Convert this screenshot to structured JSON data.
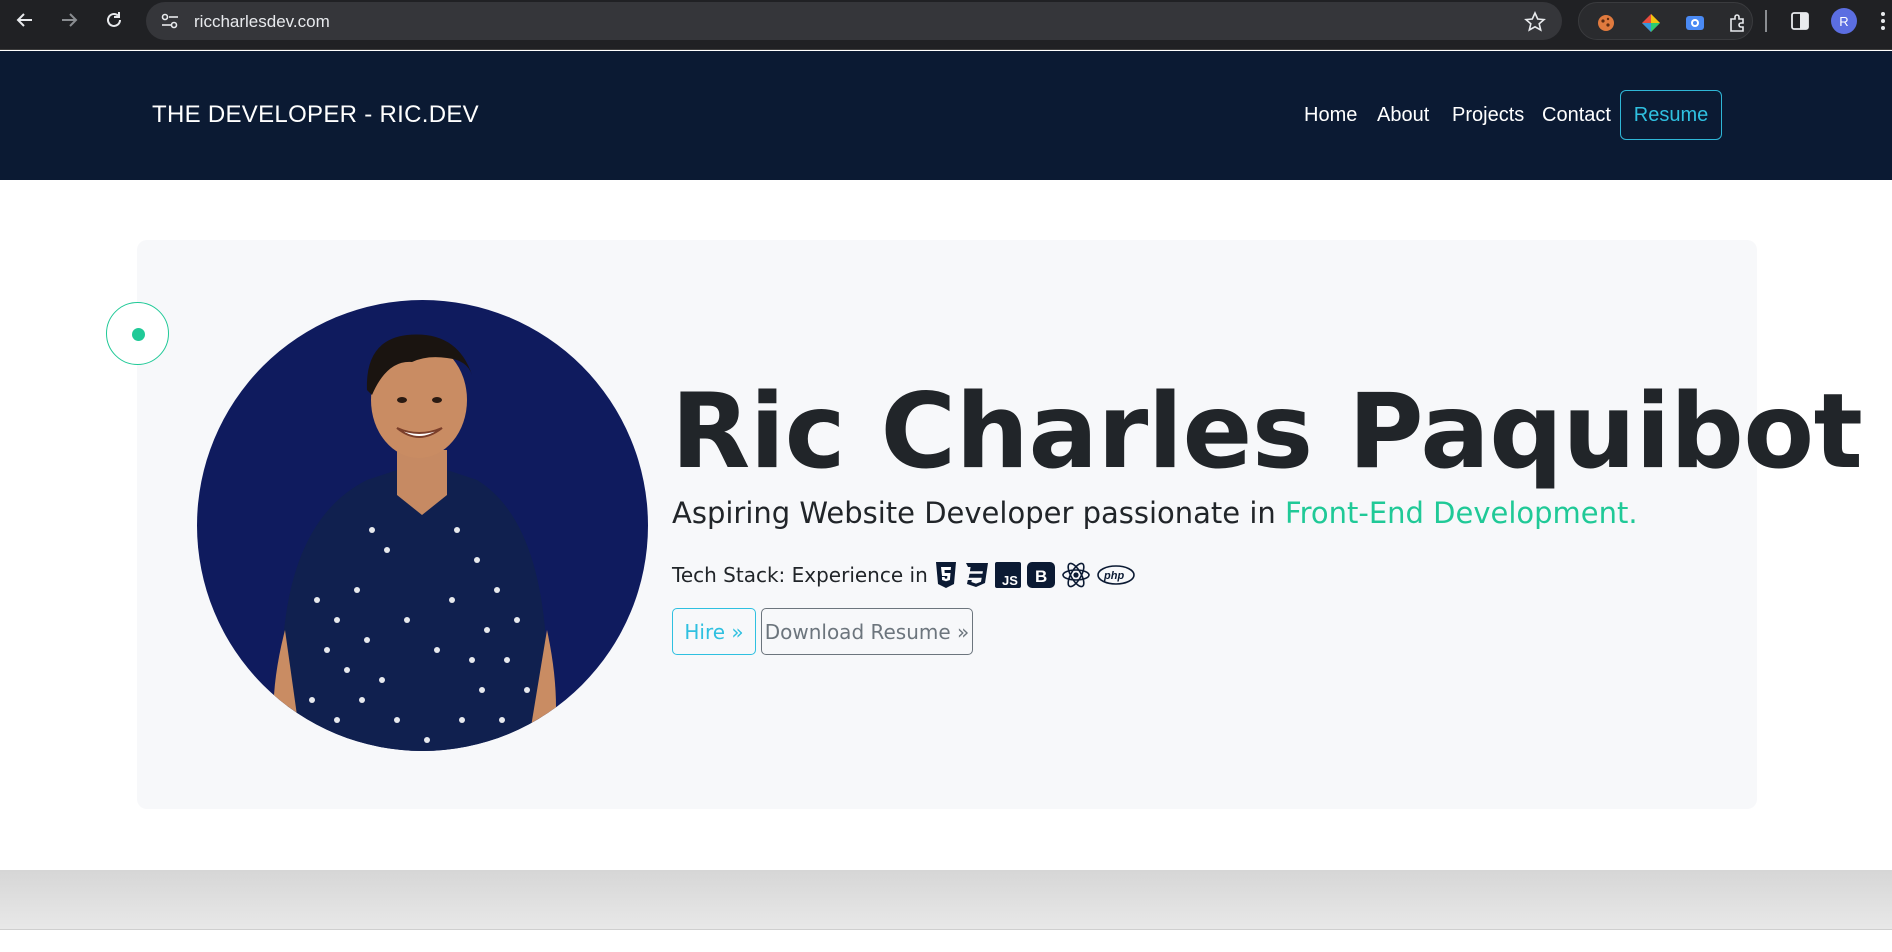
{
  "browser": {
    "url": "riccharlesdev.com",
    "profile_initial": "R",
    "icons": [
      "back-icon",
      "forward-icon",
      "reload-icon",
      "site-info-icon",
      "bookmark-star-icon",
      "cookie-extension-icon",
      "color-extension-icon",
      "screen-capture-extension-icon",
      "extensions-puzzle-icon",
      "side-panel-icon",
      "profile-avatar",
      "more-menu-icon"
    ]
  },
  "header": {
    "brand": "THE DEVELOPER - RIC.DEV",
    "nav": [
      {
        "label": "Home"
      },
      {
        "label": "About"
      },
      {
        "label": "Projects"
      },
      {
        "label": "Contact"
      }
    ],
    "resume_label": "Resume"
  },
  "hero": {
    "name": "Ric Charles Paquibot",
    "tagline_prefix": "Aspiring Website Developer passionate in ",
    "tagline_accent": "Front-End Development.",
    "tech_label": "Tech Stack: Experience in",
    "tech_icons": [
      "html5-icon",
      "css3-icon",
      "javascript-icon",
      "bootstrap-icon",
      "react-icon",
      "php-icon"
    ],
    "hire_label": "Hire »",
    "download_label": "Download Resume »"
  },
  "colors": {
    "header_bg": "#0b1a33",
    "accent_green": "#20c997",
    "accent_cyan": "#2fc0e0",
    "portrait_bg": "#0f1b5e"
  }
}
